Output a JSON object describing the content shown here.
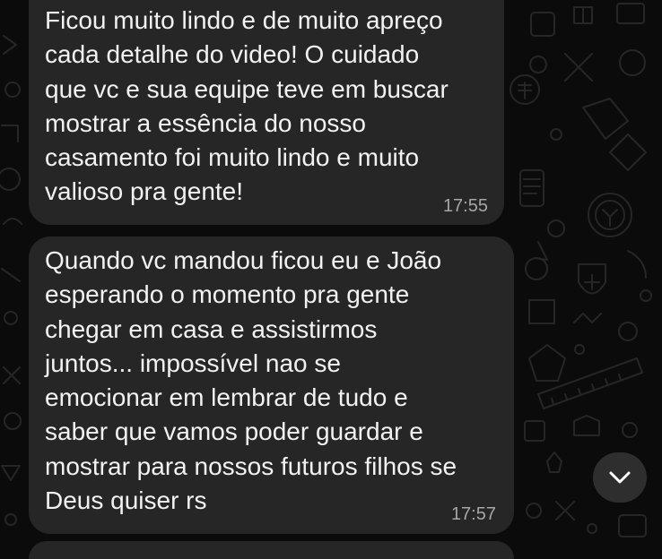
{
  "chat": {
    "messages": [
      {
        "text": "Ficou muito lindo e de muito apreço\ncada detalhe do video! O cuidado\nque vc e sua equipe teve em buscar\nmostrar a essência do nosso\ncasamento foi muito lindo e muito\nvalioso pra gente!",
        "time": "17:55"
      },
      {
        "text": "Quando vc mandou ficou eu e João\nesperando o momento pra gente\nchegar em casa e assistirmos\njuntos... impossível nao se\nemocionar em lembrar de tudo e\nsaber que vamos poder guardar e\nmostrar para nossos futuros filhos se\nDeus quiser rs",
        "time": "17:57"
      }
    ],
    "scroll_button_icon": "chevron-down-icon"
  },
  "colors": {
    "background": "#0b0b0b",
    "bubble": "#262626",
    "text": "#f2f2f2",
    "timestamp": "#a6a6a6"
  }
}
